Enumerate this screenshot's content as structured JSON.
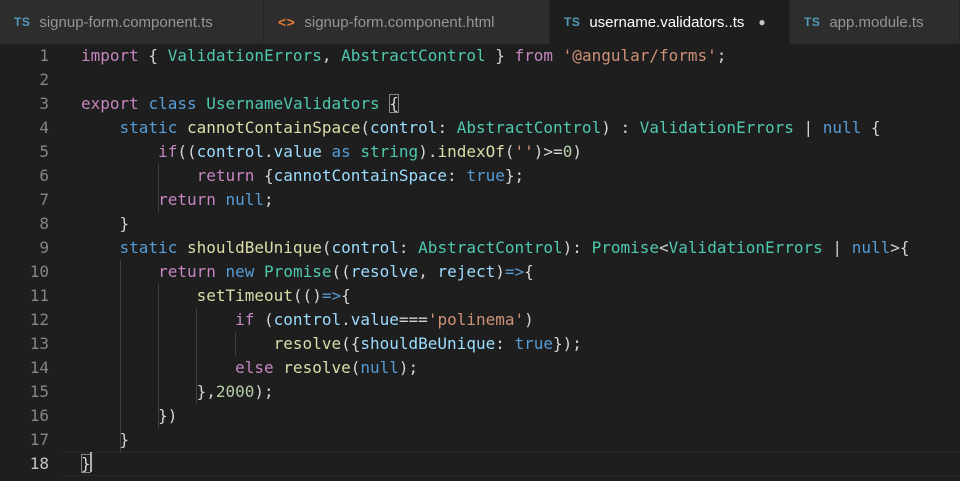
{
  "tabs": [
    {
      "label": "signup-form.component.ts",
      "icon": "TS",
      "icon_name": "typescript-file-icon",
      "active": false
    },
    {
      "label": "signup-form.component.html",
      "icon": "<>",
      "icon_name": "html-file-icon",
      "active": false
    },
    {
      "label": "username.validators..ts",
      "icon": "TS",
      "icon_name": "typescript-file-icon",
      "active": true,
      "unsaved": "●"
    },
    {
      "label": "app.module.ts",
      "icon": "TS",
      "icon_name": "typescript-file-icon",
      "active": false
    }
  ],
  "editor": {
    "current_line": 18,
    "line_numbers": [
      "1",
      "2",
      "3",
      "4",
      "5",
      "6",
      "7",
      "8",
      "9",
      "10",
      "11",
      "12",
      "13",
      "14",
      "15",
      "16",
      "17",
      "18"
    ],
    "code": [
      [
        [
          "kc",
          "import"
        ],
        [
          "p",
          " { "
        ],
        [
          "cls",
          "ValidationErrors"
        ],
        [
          "p",
          ", "
        ],
        [
          "cls",
          "AbstractControl"
        ],
        [
          "p",
          " } "
        ],
        [
          "kc",
          "from"
        ],
        [
          "p",
          " "
        ],
        [
          "str",
          "'@angular/forms'"
        ],
        [
          "p",
          ";"
        ]
      ],
      [],
      [
        [
          "kc",
          "export"
        ],
        [
          "p",
          " "
        ],
        [
          "kw",
          "class"
        ],
        [
          "p",
          " "
        ],
        [
          "cls",
          "UsernameValidators"
        ],
        [
          "p",
          " "
        ],
        [
          "brk",
          "{"
        ]
      ],
      [
        [
          "p",
          "    "
        ],
        [
          "kw",
          "static"
        ],
        [
          "p",
          " "
        ],
        [
          "fn",
          "cannotContainSpace"
        ],
        [
          "p",
          "("
        ],
        [
          "prm",
          "control"
        ],
        [
          "p",
          ": "
        ],
        [
          "cls",
          "AbstractControl"
        ],
        [
          "p",
          ") : "
        ],
        [
          "cls",
          "ValidationErrors"
        ],
        [
          "p",
          " | "
        ],
        [
          "kw",
          "null"
        ],
        [
          "p",
          " {"
        ]
      ],
      [
        [
          "p",
          "        "
        ],
        [
          "kc",
          "if"
        ],
        [
          "p",
          "(("
        ],
        [
          "prm",
          "control"
        ],
        [
          "p",
          "."
        ],
        [
          "prm",
          "value"
        ],
        [
          "p",
          " "
        ],
        [
          "kw",
          "as"
        ],
        [
          "p",
          " "
        ],
        [
          "cls",
          "string"
        ],
        [
          "p",
          ")."
        ],
        [
          "fn",
          "indexOf"
        ],
        [
          "p",
          "("
        ],
        [
          "str",
          "''"
        ],
        [
          "p",
          ")>="
        ],
        [
          "num",
          "0"
        ],
        [
          "p",
          ")"
        ]
      ],
      [
        [
          "p",
          "            "
        ],
        [
          "kc",
          "return"
        ],
        [
          "p",
          " {"
        ],
        [
          "prm",
          "cannotContainSpace"
        ],
        [
          "p",
          ": "
        ],
        [
          "kw",
          "true"
        ],
        [
          "p",
          "};"
        ]
      ],
      [
        [
          "p",
          "        "
        ],
        [
          "kc",
          "return"
        ],
        [
          "p",
          " "
        ],
        [
          "kw",
          "null"
        ],
        [
          "p",
          ";"
        ]
      ],
      [
        [
          "p",
          "    }"
        ]
      ],
      [
        [
          "p",
          "    "
        ],
        [
          "kw",
          "static"
        ],
        [
          "p",
          " "
        ],
        [
          "fn",
          "shouldBeUnique"
        ],
        [
          "p",
          "("
        ],
        [
          "prm",
          "control"
        ],
        [
          "p",
          ": "
        ],
        [
          "cls",
          "AbstractControl"
        ],
        [
          "p",
          "): "
        ],
        [
          "cls",
          "Promise"
        ],
        [
          "p",
          "<"
        ],
        [
          "cls",
          "ValidationErrors"
        ],
        [
          "p",
          " | "
        ],
        [
          "kw",
          "null"
        ],
        [
          "p",
          ">{"
        ]
      ],
      [
        [
          "p",
          "        "
        ],
        [
          "kc",
          "return"
        ],
        [
          "p",
          " "
        ],
        [
          "kw",
          "new"
        ],
        [
          "p",
          " "
        ],
        [
          "cls",
          "Promise"
        ],
        [
          "p",
          "(("
        ],
        [
          "prm",
          "resolve"
        ],
        [
          "p",
          ", "
        ],
        [
          "prm",
          "reject"
        ],
        [
          "p",
          ")"
        ],
        [
          "kw",
          "=>"
        ],
        [
          "p",
          "{"
        ]
      ],
      [
        [
          "p",
          "            "
        ],
        [
          "fn",
          "setTimeout"
        ],
        [
          "p",
          "(()"
        ],
        [
          "kw",
          "=>"
        ],
        [
          "p",
          "{"
        ]
      ],
      [
        [
          "p",
          "                "
        ],
        [
          "kc",
          "if"
        ],
        [
          "p",
          " ("
        ],
        [
          "prm",
          "control"
        ],
        [
          "p",
          "."
        ],
        [
          "prm",
          "value"
        ],
        [
          "p",
          "==="
        ],
        [
          "str",
          "'polinema'"
        ],
        [
          "p",
          ")"
        ]
      ],
      [
        [
          "p",
          "                    "
        ],
        [
          "fn",
          "resolve"
        ],
        [
          "p",
          "({"
        ],
        [
          "prm",
          "shouldBeUnique"
        ],
        [
          "p",
          ": "
        ],
        [
          "kw",
          "true"
        ],
        [
          "p",
          "});"
        ]
      ],
      [
        [
          "p",
          "                "
        ],
        [
          "kc",
          "else"
        ],
        [
          "p",
          " "
        ],
        [
          "fn",
          "resolve"
        ],
        [
          "p",
          "("
        ],
        [
          "kw",
          "null"
        ],
        [
          "p",
          ");"
        ]
      ],
      [
        [
          "p",
          "            },"
        ],
        [
          "num",
          "2000"
        ],
        [
          "p",
          ");"
        ]
      ],
      [
        [
          "p",
          "        })"
        ]
      ],
      [
        [
          "p",
          "    }"
        ]
      ],
      [
        [
          "brk",
          "}"
        ]
      ]
    ]
  }
}
